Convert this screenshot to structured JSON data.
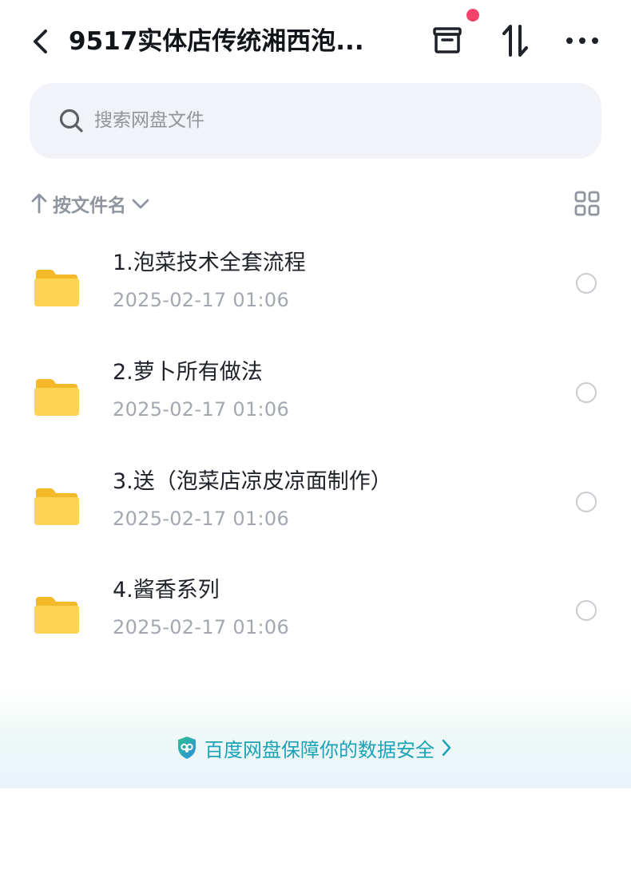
{
  "header": {
    "title": "9517实体店传统湘西泡...",
    "back_icon": "chevron-left-icon",
    "archive_icon": "archive-box-icon",
    "sort_icon": "sort-arrows-icon",
    "more_icon": "more-dots-icon",
    "badge_color": "#f5436b"
  },
  "search": {
    "placeholder": "搜索网盘文件",
    "value": "",
    "icon": "search-icon"
  },
  "sort": {
    "label": "按文件名",
    "direction_icon": "arrow-up-icon",
    "dropdown_icon": "chevron-down-icon",
    "view_toggle_icon": "grid-view-icon"
  },
  "files": [
    {
      "name": "1.泡菜技术全套流程",
      "date": "2025-02-17  01:06",
      "icon": "folder-icon"
    },
    {
      "name": "2.萝卜所有做法",
      "date": "2025-02-17  01:06",
      "icon": "folder-icon"
    },
    {
      "name": "3.送（泡菜店凉皮凉面制作）",
      "date": "2025-02-17  01:06",
      "icon": "folder-icon"
    },
    {
      "name": "4.酱香系列",
      "date": "2025-02-17  01:06",
      "icon": "folder-icon"
    }
  ],
  "footer": {
    "security_text": "百度网盘保障你的数据安全",
    "shield_icon": "shield-icon",
    "chevron_icon": "chevron-right-icon",
    "accent_color": "#1aa3b8"
  },
  "colors": {
    "folder": "#fcd34d",
    "muted_text": "#a3a8b0",
    "search_bg": "#f1f3f8"
  }
}
